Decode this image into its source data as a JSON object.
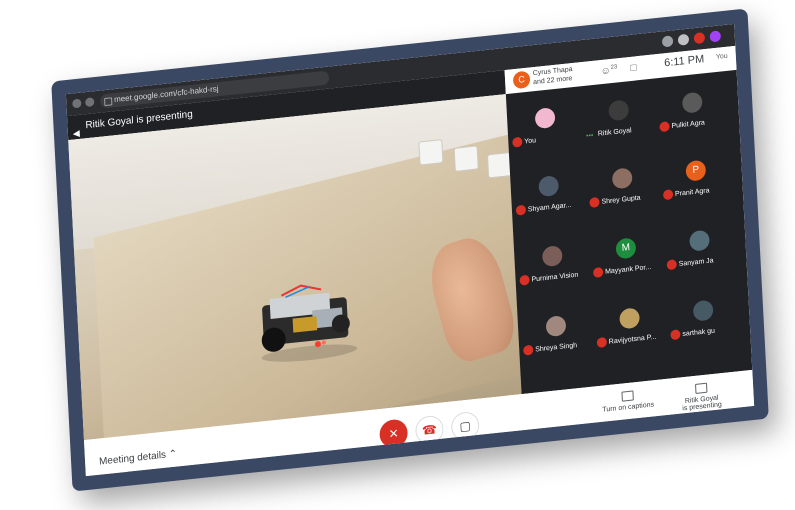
{
  "browser": {
    "url": "meet.google.com/cfc-hakd-rsj"
  },
  "meeting": {
    "presenter_banner": "Ritik Goyal is presenting",
    "host_initial": "C",
    "host_line1": "Cyrus Thapa",
    "host_line2": "and 22 more",
    "people_count": "23",
    "time": "6:11 PM",
    "self_label": "You"
  },
  "participants": [
    {
      "name": "You",
      "initial": "",
      "color": "#f2b8cf"
    },
    {
      "name": "Ritik Goyal",
      "initial": "",
      "color": "#202124"
    },
    {
      "name": "Pulkit Agra",
      "initial": "",
      "color": "#3a3a3a"
    },
    {
      "name": "Shyam Agar...",
      "initial": "",
      "color": "#4d5a6b"
    },
    {
      "name": "Shrey Gupta",
      "initial": "",
      "color": "#8d6e63"
    },
    {
      "name": "Pranit Agra",
      "initial": "P",
      "color": "#e8601c"
    },
    {
      "name": "Purnima Vision",
      "initial": "",
      "color": "#7b5e57"
    },
    {
      "name": "Mayyank Por...",
      "initial": "M",
      "color": "#1e8e3e"
    },
    {
      "name": "Sanyam Ja",
      "initial": "",
      "color": "#546e7a"
    },
    {
      "name": "Shreya Singh",
      "initial": "",
      "color": "#a1887f"
    },
    {
      "name": "Ravijyotsna P...",
      "initial": "",
      "color": "#c0a060"
    },
    {
      "name": "sarthak gu",
      "initial": "",
      "color": "#455a64"
    }
  ],
  "bottom_bar": {
    "meeting_details": "Meeting details",
    "captions": "Turn on captions",
    "present_line1": "Ritik Goyal",
    "present_line2": "is presenting"
  }
}
